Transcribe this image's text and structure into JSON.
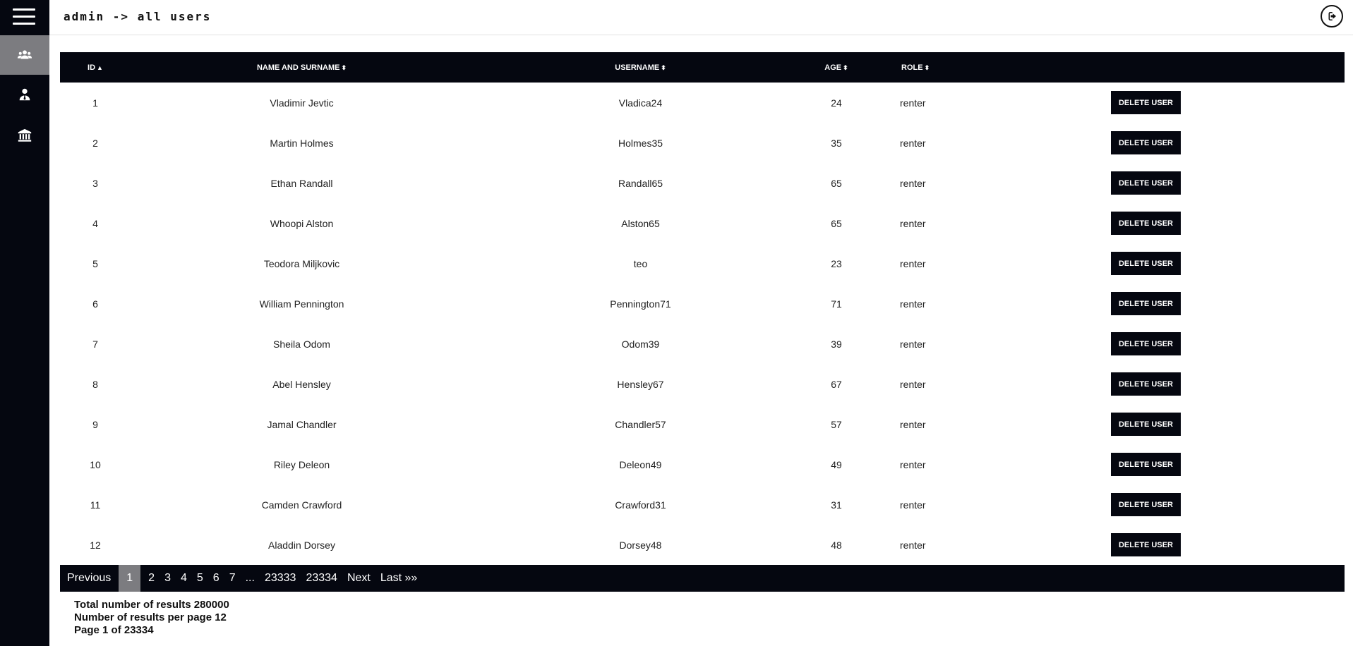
{
  "header": {
    "breadcrumb": "admin -> all users"
  },
  "sidebar": {
    "items": [
      {
        "name": "users",
        "icon": "users-icon",
        "active": true
      },
      {
        "name": "profile",
        "icon": "user-tie-icon",
        "active": false
      },
      {
        "name": "bank",
        "icon": "bank-icon",
        "active": false
      }
    ]
  },
  "table": {
    "columns": {
      "id": "ID",
      "name": "NAME AND SURNAME",
      "username": "USERNAME",
      "age": "AGE",
      "role": "ROLE"
    },
    "sort": {
      "column": "id",
      "direction": "asc"
    },
    "delete_label": "DELETE USER",
    "rows": [
      {
        "id": "1",
        "name": "Vladimir Jevtic",
        "username": "Vladica24",
        "age": "24",
        "role": "renter"
      },
      {
        "id": "2",
        "name": "Martin Holmes",
        "username": "Holmes35",
        "age": "35",
        "role": "renter"
      },
      {
        "id": "3",
        "name": "Ethan Randall",
        "username": "Randall65",
        "age": "65",
        "role": "renter"
      },
      {
        "id": "4",
        "name": "Whoopi Alston",
        "username": "Alston65",
        "age": "65",
        "role": "renter"
      },
      {
        "id": "5",
        "name": "Teodora Miljkovic",
        "username": "teo",
        "age": "23",
        "role": "renter"
      },
      {
        "id": "6",
        "name": "William Pennington",
        "username": "Pennington71",
        "age": "71",
        "role": "renter"
      },
      {
        "id": "7",
        "name": "Sheila Odom",
        "username": "Odom39",
        "age": "39",
        "role": "renter"
      },
      {
        "id": "8",
        "name": "Abel Hensley",
        "username": "Hensley67",
        "age": "67",
        "role": "renter"
      },
      {
        "id": "9",
        "name": "Jamal Chandler",
        "username": "Chandler57",
        "age": "57",
        "role": "renter"
      },
      {
        "id": "10",
        "name": "Riley Deleon",
        "username": "Deleon49",
        "age": "49",
        "role": "renter"
      },
      {
        "id": "11",
        "name": "Camden Crawford",
        "username": "Crawford31",
        "age": "31",
        "role": "renter"
      },
      {
        "id": "12",
        "name": "Aladdin Dorsey",
        "username": "Dorsey48",
        "age": "48",
        "role": "renter"
      }
    ]
  },
  "pagination": {
    "previous": "Previous",
    "pages": [
      "1",
      "2",
      "3",
      "4",
      "5",
      "6",
      "7"
    ],
    "current": "1",
    "ellipsis": "...",
    "tail_pages": [
      "23333",
      "23334"
    ],
    "next": "Next",
    "last": "Last »»"
  },
  "stats": {
    "total": "Total number of results 280000",
    "per_page": "Number of results per page 12",
    "page_of": "Page 1 of 23334"
  },
  "colors": {
    "dark": "#050710",
    "active": "#7c7c80"
  }
}
